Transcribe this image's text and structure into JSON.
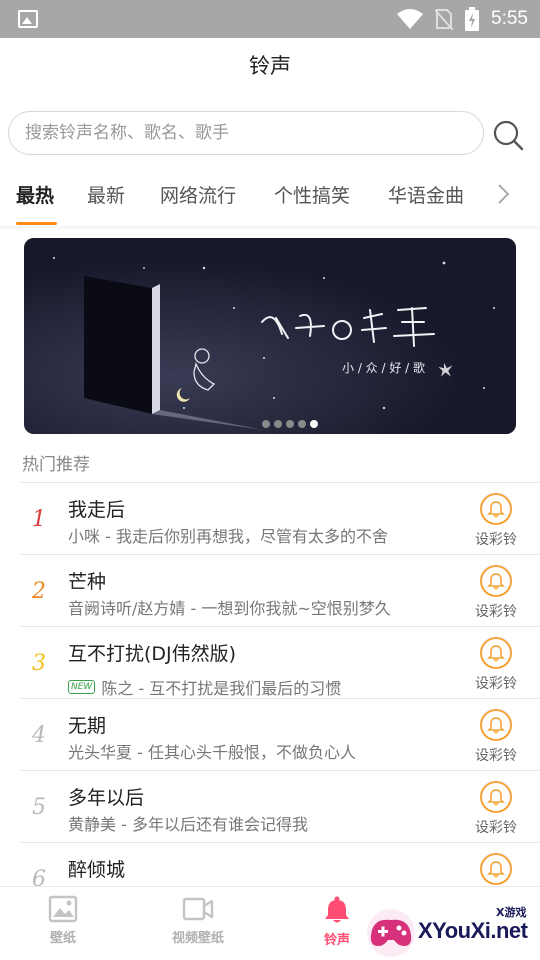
{
  "status_bar": {
    "time": "5:55"
  },
  "header": {
    "title": "铃声"
  },
  "search": {
    "placeholder": "搜索铃声名称、歌名、歌手"
  },
  "tabs": [
    {
      "label": "最热",
      "active": true
    },
    {
      "label": "最新"
    },
    {
      "label": "网络流行"
    },
    {
      "label": "个性搞笑"
    },
    {
      "label": "华语金曲"
    }
  ],
  "banner": {
    "title_art": "隐秘の歌单",
    "subtitle_art": "小/众/好/歌",
    "dots": 5,
    "active_dot": 5
  },
  "section": {
    "title": "热门推荐"
  },
  "songs": [
    {
      "rank": "1",
      "title": "我走后",
      "desc": "小咪 - 我走后你别再想我，尽管有太多的不舍",
      "rank_color": "#d93b3b",
      "action": "设彩铃"
    },
    {
      "rank": "2",
      "title": "芒种",
      "desc": "音阙诗听/赵方婧 - 一想到你我就~空恨别梦久",
      "rank_color": "#f08a24",
      "action": "设彩铃"
    },
    {
      "rank": "3",
      "title": "互不打扰(DJ伟然版)",
      "desc": "陈之 - 互不打扰是我们最后的习惯",
      "badge": "NEW",
      "rank_color": "#f2c21c",
      "action": "设彩铃"
    },
    {
      "rank": "4",
      "title": "无期",
      "desc": "光头华夏 - 任其心头千般恨，不做负心人",
      "rank_color": "#b8b8b8",
      "action": "设彩铃"
    },
    {
      "rank": "5",
      "title": "多年以后",
      "desc": "黄静美 - 多年以后还有谁会记得我",
      "rank_color": "#b8b8b8",
      "action": "设彩铃"
    },
    {
      "rank": "6",
      "title": "醉倾城",
      "desc": "",
      "rank_color": "#b8b8b8",
      "action": "设彩铃"
    }
  ],
  "bottom_nav": [
    {
      "label": "壁纸",
      "icon": "image-icon"
    },
    {
      "label": "视频壁纸",
      "icon": "video-icon"
    },
    {
      "label": "铃声",
      "icon": "bell-icon",
      "active": true
    }
  ],
  "watermark": {
    "site": "XYouXi.net",
    "small": "X游戏"
  },
  "colors": {
    "accent": "#ff8a14",
    "active_nav": "#ff4d74",
    "bell": "#f4a23a"
  }
}
